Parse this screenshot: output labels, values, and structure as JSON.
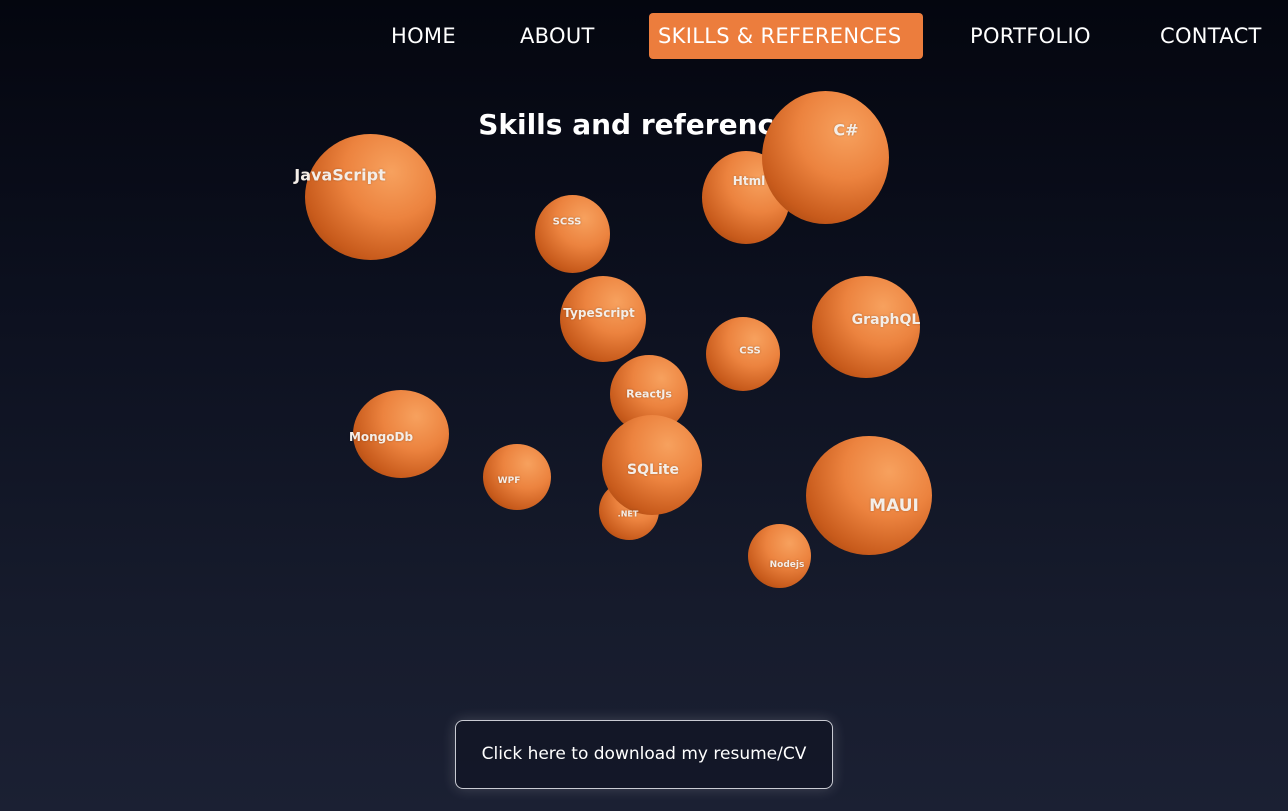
{
  "nav": {
    "items": [
      {
        "label": "HOME",
        "active": false
      },
      {
        "label": "ABOUT",
        "active": false
      },
      {
        "label": "SKILLS & REFERENCES",
        "active": true
      },
      {
        "label": "PORTFOLIO",
        "active": false
      },
      {
        "label": "CONTACT",
        "active": false
      }
    ],
    "accent_color": "#ec7d3d"
  },
  "page": {
    "title": "Skills and references"
  },
  "skills": [
    "JavaScript",
    "C#",
    "Html",
    "SCSS",
    "TypeScript",
    "GraphQL",
    "CSS",
    "ReactJs",
    "MongoDb",
    "WPF",
    "SQLite",
    ".NET",
    "MAUI",
    "Nodejs"
  ],
  "cv_button": {
    "label": "Click here to download my resume/CV"
  },
  "colors": {
    "ball": "#ec833f",
    "background": "#0d1120"
  }
}
